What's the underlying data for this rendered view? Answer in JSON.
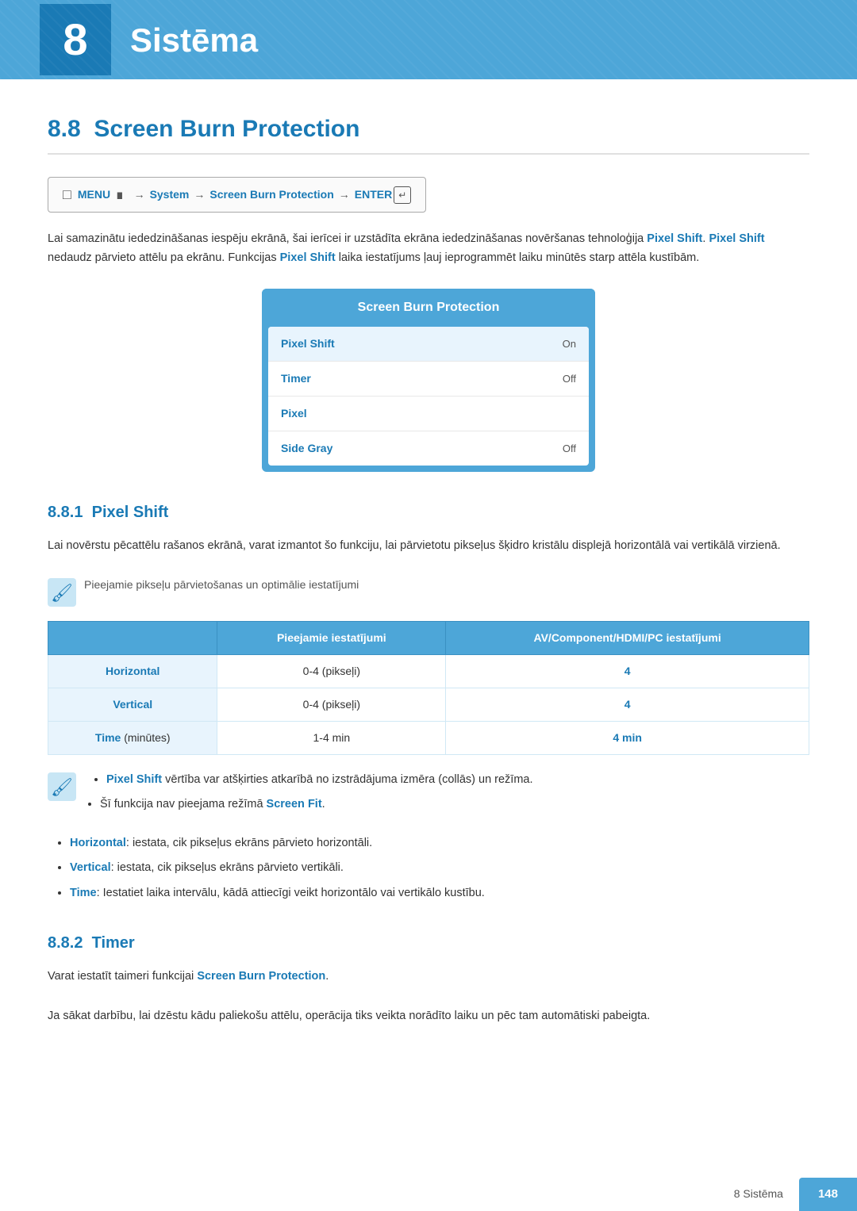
{
  "chapter": {
    "number": "8",
    "title": "Sistēma"
  },
  "section": {
    "number": "8.8",
    "title": "Screen Burn Protection"
  },
  "menu_path": {
    "icon_label": "menu-icon",
    "parts": [
      "MENU",
      "System",
      "Screen Burn Protection",
      "ENTER"
    ]
  },
  "description": "Lai samazinātu iededzināšanas iespēju ekrānā, šai ierīcei ir uzstādīta ekrāna iededzināšanas novēršanas tehnoloģija Pixel Shift. Pixel Shift nedaudz pārvieto attēlu pa ekrānu. Funkcijas Pixel Shift laika iestatījums ļauj ieprogrammēt laiku minūtēs starp attēla kustībām.",
  "description_highlights": [
    "Pixel Shift",
    "Pixel Shift",
    "Pixel Shift"
  ],
  "menu_box": {
    "title": "Screen Burn Protection",
    "items": [
      {
        "label": "Pixel Shift",
        "value": "On",
        "highlighted": true
      },
      {
        "label": "Timer",
        "value": "Off",
        "highlighted": false
      },
      {
        "label": "Pixel",
        "value": "",
        "highlighted": false
      },
      {
        "label": "Side Gray",
        "value": "Off",
        "highlighted": false
      }
    ]
  },
  "subsection_1": {
    "number": "8.8.1",
    "title": "Pixel Shift",
    "description": "Lai novērstu pēcattēlu rašanos ekrānā, varat izmantot šo funkciju, lai pārvietotu pikseļus šķidro kristālu displejā horizontālā vai vertikālā virzienā.",
    "note": "Pieejamie pikseļu pārvietošanas un optimālie iestatījumi",
    "table": {
      "headers": [
        "",
        "Pieejamie iestatījumi",
        "AV/Component/HDMI/PC iestatījumi"
      ],
      "rows": [
        {
          "label": "Horizontal",
          "col1": "0-4 (pikseļi)",
          "col2": "4"
        },
        {
          "label": "Vertical",
          "col1": "0-4 (pikseļi)",
          "col2": "4"
        },
        {
          "label": "Time (minūtes)",
          "col1": "1-4 min",
          "col2": "4 min"
        }
      ]
    },
    "bullets_note": [
      "Pixel Shift vērtība var atšķirties atkarībā no izstrādājuma izmēra (collās) un režīma.",
      "Šī funkcija nav pieejama režīmā Screen Fit."
    ],
    "bullets": [
      {
        "term": "Horizontal",
        "text": ": iestata, cik pikseļus ekrāns pārvieto horizontāli."
      },
      {
        "term": "Vertical",
        "text": ": iestata, cik pikseļus ekrāns pārvieto vertikāli."
      },
      {
        "term": "Time",
        "text": ": Iestatiet laika intervālu, kādā attiecīgi veikt horizontālo vai vertikālo kustību."
      }
    ]
  },
  "subsection_2": {
    "number": "8.8.2",
    "title": "Timer",
    "description1": "Varat iestatīt taimeri funkcijai Screen Burn Protection.",
    "description2": "Ja sākat darbību, lai dzēstu kādu paliekošu attēlu, operācija tiks veikta norādīto laiku un pēc tam automātiski pabeigta.",
    "highlight": "Screen Burn Protection"
  },
  "footer": {
    "section_label": "8 Sistēma",
    "page_number": "148"
  }
}
